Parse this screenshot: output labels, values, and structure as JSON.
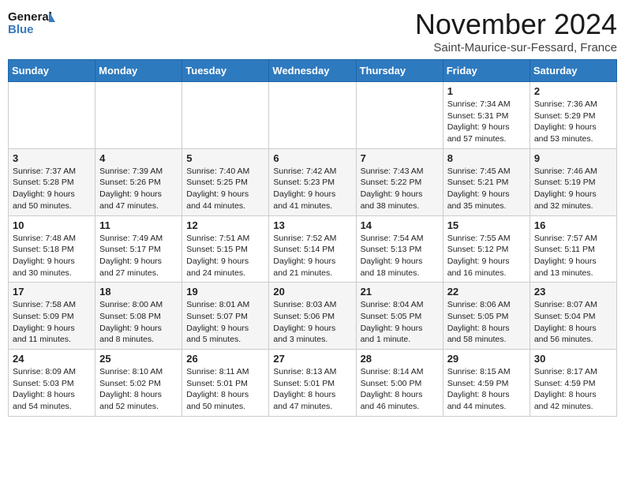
{
  "header": {
    "logo_line1": "General",
    "logo_line2": "Blue",
    "month_title": "November 2024",
    "location": "Saint-Maurice-sur-Fessard, France"
  },
  "weekdays": [
    "Sunday",
    "Monday",
    "Tuesday",
    "Wednesday",
    "Thursday",
    "Friday",
    "Saturday"
  ],
  "weeks": [
    [
      {
        "day": "",
        "info": ""
      },
      {
        "day": "",
        "info": ""
      },
      {
        "day": "",
        "info": ""
      },
      {
        "day": "",
        "info": ""
      },
      {
        "day": "",
        "info": ""
      },
      {
        "day": "1",
        "info": "Sunrise: 7:34 AM\nSunset: 5:31 PM\nDaylight: 9 hours and 57 minutes."
      },
      {
        "day": "2",
        "info": "Sunrise: 7:36 AM\nSunset: 5:29 PM\nDaylight: 9 hours and 53 minutes."
      }
    ],
    [
      {
        "day": "3",
        "info": "Sunrise: 7:37 AM\nSunset: 5:28 PM\nDaylight: 9 hours and 50 minutes."
      },
      {
        "day": "4",
        "info": "Sunrise: 7:39 AM\nSunset: 5:26 PM\nDaylight: 9 hours and 47 minutes."
      },
      {
        "day": "5",
        "info": "Sunrise: 7:40 AM\nSunset: 5:25 PM\nDaylight: 9 hours and 44 minutes."
      },
      {
        "day": "6",
        "info": "Sunrise: 7:42 AM\nSunset: 5:23 PM\nDaylight: 9 hours and 41 minutes."
      },
      {
        "day": "7",
        "info": "Sunrise: 7:43 AM\nSunset: 5:22 PM\nDaylight: 9 hours and 38 minutes."
      },
      {
        "day": "8",
        "info": "Sunrise: 7:45 AM\nSunset: 5:21 PM\nDaylight: 9 hours and 35 minutes."
      },
      {
        "day": "9",
        "info": "Sunrise: 7:46 AM\nSunset: 5:19 PM\nDaylight: 9 hours and 32 minutes."
      }
    ],
    [
      {
        "day": "10",
        "info": "Sunrise: 7:48 AM\nSunset: 5:18 PM\nDaylight: 9 hours and 30 minutes."
      },
      {
        "day": "11",
        "info": "Sunrise: 7:49 AM\nSunset: 5:17 PM\nDaylight: 9 hours and 27 minutes."
      },
      {
        "day": "12",
        "info": "Sunrise: 7:51 AM\nSunset: 5:15 PM\nDaylight: 9 hours and 24 minutes."
      },
      {
        "day": "13",
        "info": "Sunrise: 7:52 AM\nSunset: 5:14 PM\nDaylight: 9 hours and 21 minutes."
      },
      {
        "day": "14",
        "info": "Sunrise: 7:54 AM\nSunset: 5:13 PM\nDaylight: 9 hours and 18 minutes."
      },
      {
        "day": "15",
        "info": "Sunrise: 7:55 AM\nSunset: 5:12 PM\nDaylight: 9 hours and 16 minutes."
      },
      {
        "day": "16",
        "info": "Sunrise: 7:57 AM\nSunset: 5:11 PM\nDaylight: 9 hours and 13 minutes."
      }
    ],
    [
      {
        "day": "17",
        "info": "Sunrise: 7:58 AM\nSunset: 5:09 PM\nDaylight: 9 hours and 11 minutes."
      },
      {
        "day": "18",
        "info": "Sunrise: 8:00 AM\nSunset: 5:08 PM\nDaylight: 9 hours and 8 minutes."
      },
      {
        "day": "19",
        "info": "Sunrise: 8:01 AM\nSunset: 5:07 PM\nDaylight: 9 hours and 5 minutes."
      },
      {
        "day": "20",
        "info": "Sunrise: 8:03 AM\nSunset: 5:06 PM\nDaylight: 9 hours and 3 minutes."
      },
      {
        "day": "21",
        "info": "Sunrise: 8:04 AM\nSunset: 5:05 PM\nDaylight: 9 hours and 1 minute."
      },
      {
        "day": "22",
        "info": "Sunrise: 8:06 AM\nSunset: 5:05 PM\nDaylight: 8 hours and 58 minutes."
      },
      {
        "day": "23",
        "info": "Sunrise: 8:07 AM\nSunset: 5:04 PM\nDaylight: 8 hours and 56 minutes."
      }
    ],
    [
      {
        "day": "24",
        "info": "Sunrise: 8:09 AM\nSunset: 5:03 PM\nDaylight: 8 hours and 54 minutes."
      },
      {
        "day": "25",
        "info": "Sunrise: 8:10 AM\nSunset: 5:02 PM\nDaylight: 8 hours and 52 minutes."
      },
      {
        "day": "26",
        "info": "Sunrise: 8:11 AM\nSunset: 5:01 PM\nDaylight: 8 hours and 50 minutes."
      },
      {
        "day": "27",
        "info": "Sunrise: 8:13 AM\nSunset: 5:01 PM\nDaylight: 8 hours and 47 minutes."
      },
      {
        "day": "28",
        "info": "Sunrise: 8:14 AM\nSunset: 5:00 PM\nDaylight: 8 hours and 46 minutes."
      },
      {
        "day": "29",
        "info": "Sunrise: 8:15 AM\nSunset: 4:59 PM\nDaylight: 8 hours and 44 minutes."
      },
      {
        "day": "30",
        "info": "Sunrise: 8:17 AM\nSunset: 4:59 PM\nDaylight: 8 hours and 42 minutes."
      }
    ]
  ]
}
